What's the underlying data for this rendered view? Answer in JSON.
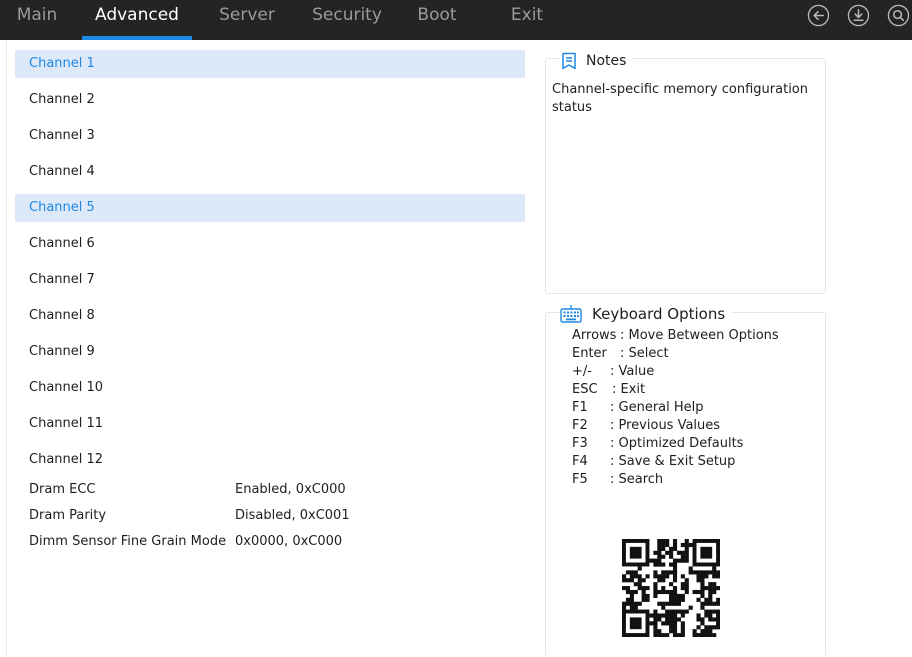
{
  "nav": {
    "tabs": [
      {
        "label": "Main",
        "active": false
      },
      {
        "label": "Advanced",
        "active": true
      },
      {
        "label": "Server",
        "active": false
      },
      {
        "label": "Security",
        "active": false
      },
      {
        "label": "Boot",
        "active": false
      },
      {
        "label": "Exit",
        "active": false
      }
    ],
    "icons": [
      "back-icon",
      "save-download-icon",
      "search-icon"
    ]
  },
  "channels": [
    {
      "label": "Channel 1",
      "selected": true
    },
    {
      "label": "Channel 2",
      "selected": false
    },
    {
      "label": "Channel 3",
      "selected": false
    },
    {
      "label": "Channel 4",
      "selected": false
    },
    {
      "label": "Channel 5",
      "selected": true
    },
    {
      "label": "Channel 6",
      "selected": false
    },
    {
      "label": "Channel 7",
      "selected": false
    },
    {
      "label": "Channel 8",
      "selected": false
    },
    {
      "label": "Channel 9",
      "selected": false
    },
    {
      "label": "Channel 10",
      "selected": false
    },
    {
      "label": "Channel 11",
      "selected": false
    },
    {
      "label": "Channel 12",
      "selected": false
    }
  ],
  "settings": [
    {
      "label": "Dram ECC",
      "value": "Enabled, 0xC000"
    },
    {
      "label": "Dram Parity",
      "value": "Disabled, 0xC001"
    },
    {
      "label": "Dimm Sensor Fine Grain Mode",
      "value": "0x0000, 0xC000"
    }
  ],
  "notes": {
    "title": "Notes",
    "text": "Channel-specific memory configuration status"
  },
  "keyboard": {
    "title": "Keyboard Options",
    "lines": [
      {
        "key": "Arrows",
        "desc": ": Move Between Options"
      },
      {
        "key": "Enter",
        "desc": ": Select"
      },
      {
        "key": "+/-",
        "desc": ": Value"
      },
      {
        "key": "ESC",
        "desc": ": Exit"
      },
      {
        "key": "F1",
        "desc": ": General Help"
      },
      {
        "key": "F2",
        "desc": ": Previous Values"
      },
      {
        "key": "F3",
        "desc": ": Optimized Defaults"
      },
      {
        "key": "F4",
        "desc": ": Save & Exit Setup"
      },
      {
        "key": "F5",
        "desc": ": Search"
      }
    ]
  },
  "colors": {
    "accent": "#1e88e5",
    "topbar": "#242424",
    "selected_bg": "#dde9f8"
  }
}
